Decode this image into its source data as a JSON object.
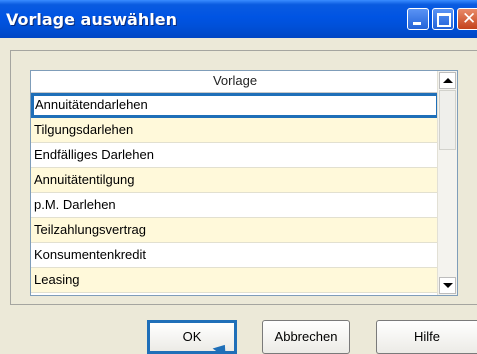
{
  "window": {
    "title": "Vorlage auswählen"
  },
  "list": {
    "header": "Vorlage",
    "items": [
      "Annuitätendarlehen",
      "Tilgungsdarlehen",
      "Endfälliges Darlehen",
      "Annuitätentilgung",
      "p.M. Darlehen",
      "Teilzahlungsvertrag",
      "Konsumentenkredit",
      "Leasing"
    ],
    "selected_index": 0
  },
  "buttons": {
    "ok": "OK",
    "cancel": "Abbrechen",
    "help": "Hilfe"
  },
  "colors": {
    "titlebar": "#0054E3",
    "highlight": "#1F6FB8",
    "row_alt": "#FFF9DA",
    "dialog_bg": "#ECE9D8"
  }
}
